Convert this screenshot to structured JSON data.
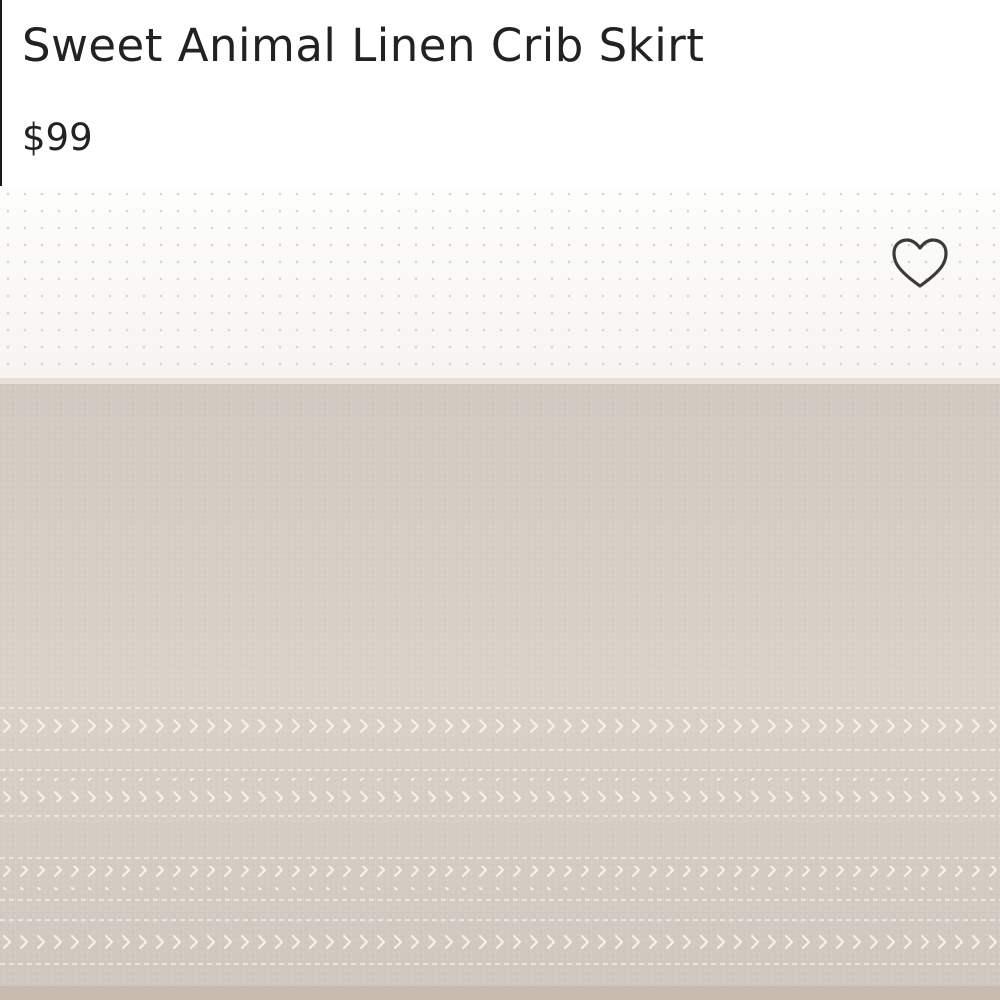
{
  "product": {
    "title": "Sweet Animal Linen Crib Skirt",
    "price": "$99"
  },
  "favorite_button": {
    "icon": "heart-outline-icon",
    "selected": false
  },
  "colors": {
    "text": "#222222",
    "sheet": "#fbfaf8",
    "sheet_dots": "#d9d4cf",
    "linen": "#dad2c9",
    "stitching": "#f4f1ec",
    "heart_stroke": "#3a3a3a"
  }
}
